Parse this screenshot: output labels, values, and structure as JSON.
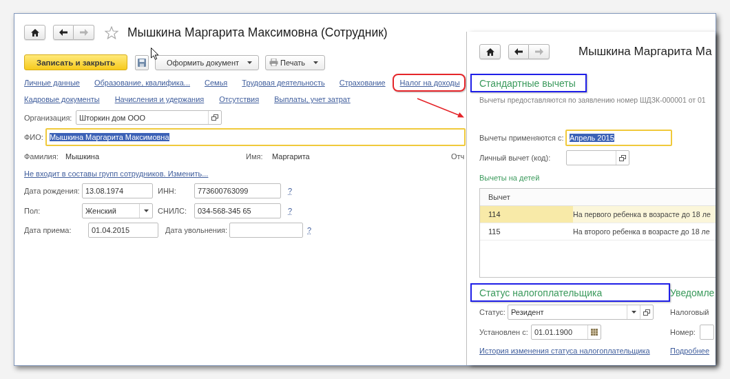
{
  "main_window": {
    "title": "Мышкина Маргарита Максимовна (Сотрудник)",
    "favorite": false,
    "back_enabled": true,
    "forward_enabled": false,
    "toolbar": {
      "save_close": "Записать и закрыть",
      "menus": [
        {
          "label": "Оформить документ",
          "kind": "plain"
        },
        {
          "label": "Печать",
          "kind": "print"
        }
      ]
    },
    "link_rows": [
      [
        {
          "label": "Личные данные",
          "circled": false
        },
        {
          "label": "Образование, квалифика...",
          "circled": false
        },
        {
          "label": "Семья",
          "circled": false
        },
        {
          "label": "Трудовая деятельность",
          "circled": false
        },
        {
          "label": "Страхование",
          "circled": false
        },
        {
          "label": "Налог на доходы",
          "circled": true
        }
      ],
      [
        {
          "label": "Кадровые документы",
          "circled": false
        },
        {
          "label": "Начисления и удержания",
          "circled": false
        },
        {
          "label": "Отсутствия",
          "circled": false
        },
        {
          "label": "Выплаты, учет затрат",
          "circled": false
        }
      ]
    ],
    "organization": {
      "label": "Организация:",
      "value": "Шторкин дом ООО",
      "kind": "lookup"
    },
    "full_name": {
      "label": "ФИО:",
      "value": "Мышкина Маргарита Максимовна",
      "kind": "text",
      "focused": true
    },
    "name_parts": [
      {
        "label": "Фамилия:",
        "value": "Мышкина"
      },
      {
        "label": "Имя:",
        "value": "Маргарита"
      },
      {
        "label": "Отч"
      }
    ],
    "groups_link": "Не входит в составы групп сотрудников. Изменить...",
    "form_rows": [
      [
        {
          "label": "Дата рождения:",
          "value": "13.08.1974",
          "kind": "text"
        },
        {
          "label": "ИНН:",
          "value": "773600763099",
          "kind": "text",
          "help": "?"
        }
      ],
      [
        {
          "label": "Пол:",
          "value": "Женский",
          "kind": "select"
        },
        {
          "label": "СНИЛС:",
          "value": "034-568-345 65",
          "kind": "text",
          "help": "?"
        }
      ],
      [
        {
          "label": "Дата приема:",
          "value": "01.04.2015",
          "kind": "text"
        },
        {
          "label": "Дата увольнения:",
          "kind": "text",
          "help": "?"
        }
      ]
    ]
  },
  "tax_window": {
    "title": "Мышкина Маргарита Ма",
    "back_enabled": true,
    "forward_enabled": false,
    "deductions": {
      "heading": {
        "text": "Стандартные вычеты",
        "boxed": true
      },
      "note": "Вычеты предоставляются по заявлению номер ШДЗК-000001 от 01",
      "start": {
        "label": "Вычеты применяются с:",
        "value": "Апрель 2015",
        "kind": "text",
        "focused": true
      },
      "personal_code": {
        "label": "Личный вычет (код):",
        "kind": "lookup"
      },
      "children_title": "Вычеты на детей",
      "table": {
        "columns": [
          "Вычет"
        ],
        "rows": [
          {
            "code": "114",
            "description": "На первого ребенка в возрасте до 18 ле",
            "selected": true
          },
          {
            "code": "115",
            "description": "На второго ребенка в возрасте до 18 ле",
            "selected": false
          }
        ]
      }
    },
    "status": {
      "heading": {
        "text": "Статус налогоплательщика",
        "boxed": true
      },
      "fields": [
        {
          "label": "Статус:",
          "value": "Резидент",
          "kind": "select_lookup"
        },
        {
          "label": "Установлен с:",
          "value": "01.01.1900",
          "kind": "date"
        }
      ],
      "link": "История изменения статуса налогоплательщика"
    },
    "notice": {
      "heading": {
        "text": "Уведомле",
        "boxed": false
      },
      "fields": [
        {
          "label": "Налоговый",
          "kind": "label"
        },
        {
          "label": "Номер:",
          "kind": "text"
        }
      ],
      "link": "Подробнее"
    }
  },
  "callout_arrow": true
}
